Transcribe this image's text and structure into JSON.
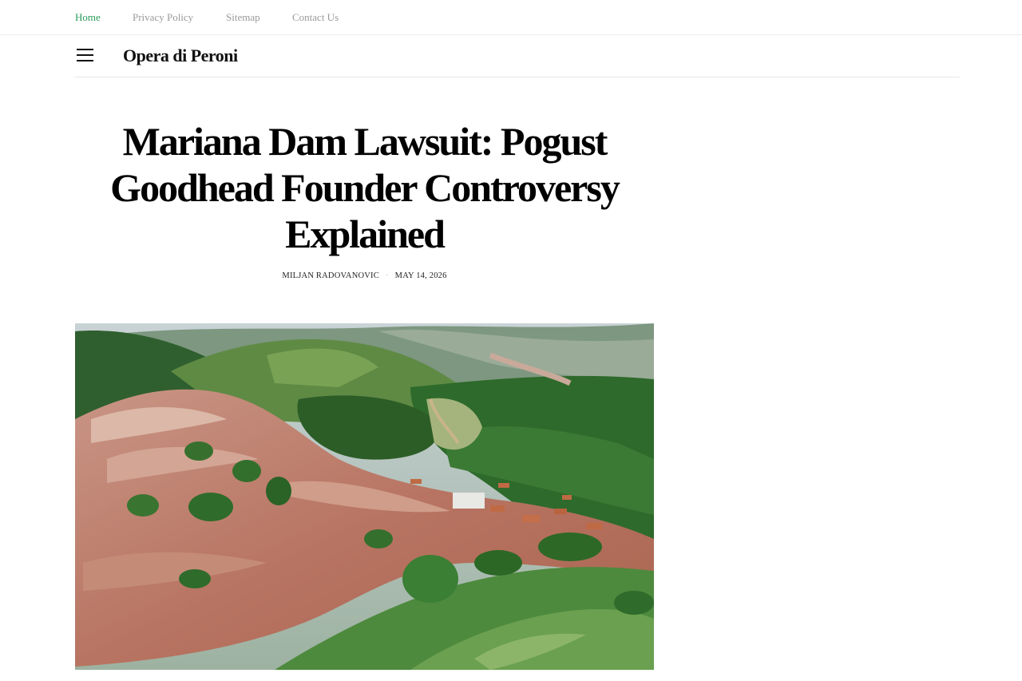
{
  "topnav": {
    "items": [
      {
        "label": "Home",
        "active": true
      },
      {
        "label": "Privacy Policy",
        "active": false
      },
      {
        "label": "Sitemap",
        "active": false
      },
      {
        "label": "Contact Us",
        "active": false
      }
    ]
  },
  "header": {
    "menu_icon": "hamburger-menu-icon",
    "brand": "Opera di Peroni"
  },
  "article": {
    "title_lines": [
      "Mariana Dam Lawsuit: Pogust",
      "Goodhead Founder Controversy",
      "Explained"
    ],
    "author": "MILJAN RADOVANOVIC",
    "date": "MAY 14, 2026",
    "featured_image": "aerial view of mud-flooded village in green valley"
  },
  "colors": {
    "accent": "#2a9d5c",
    "nav_text": "#9a9a9a",
    "mud": "#b7725c",
    "forest": "#2f6a2c"
  }
}
